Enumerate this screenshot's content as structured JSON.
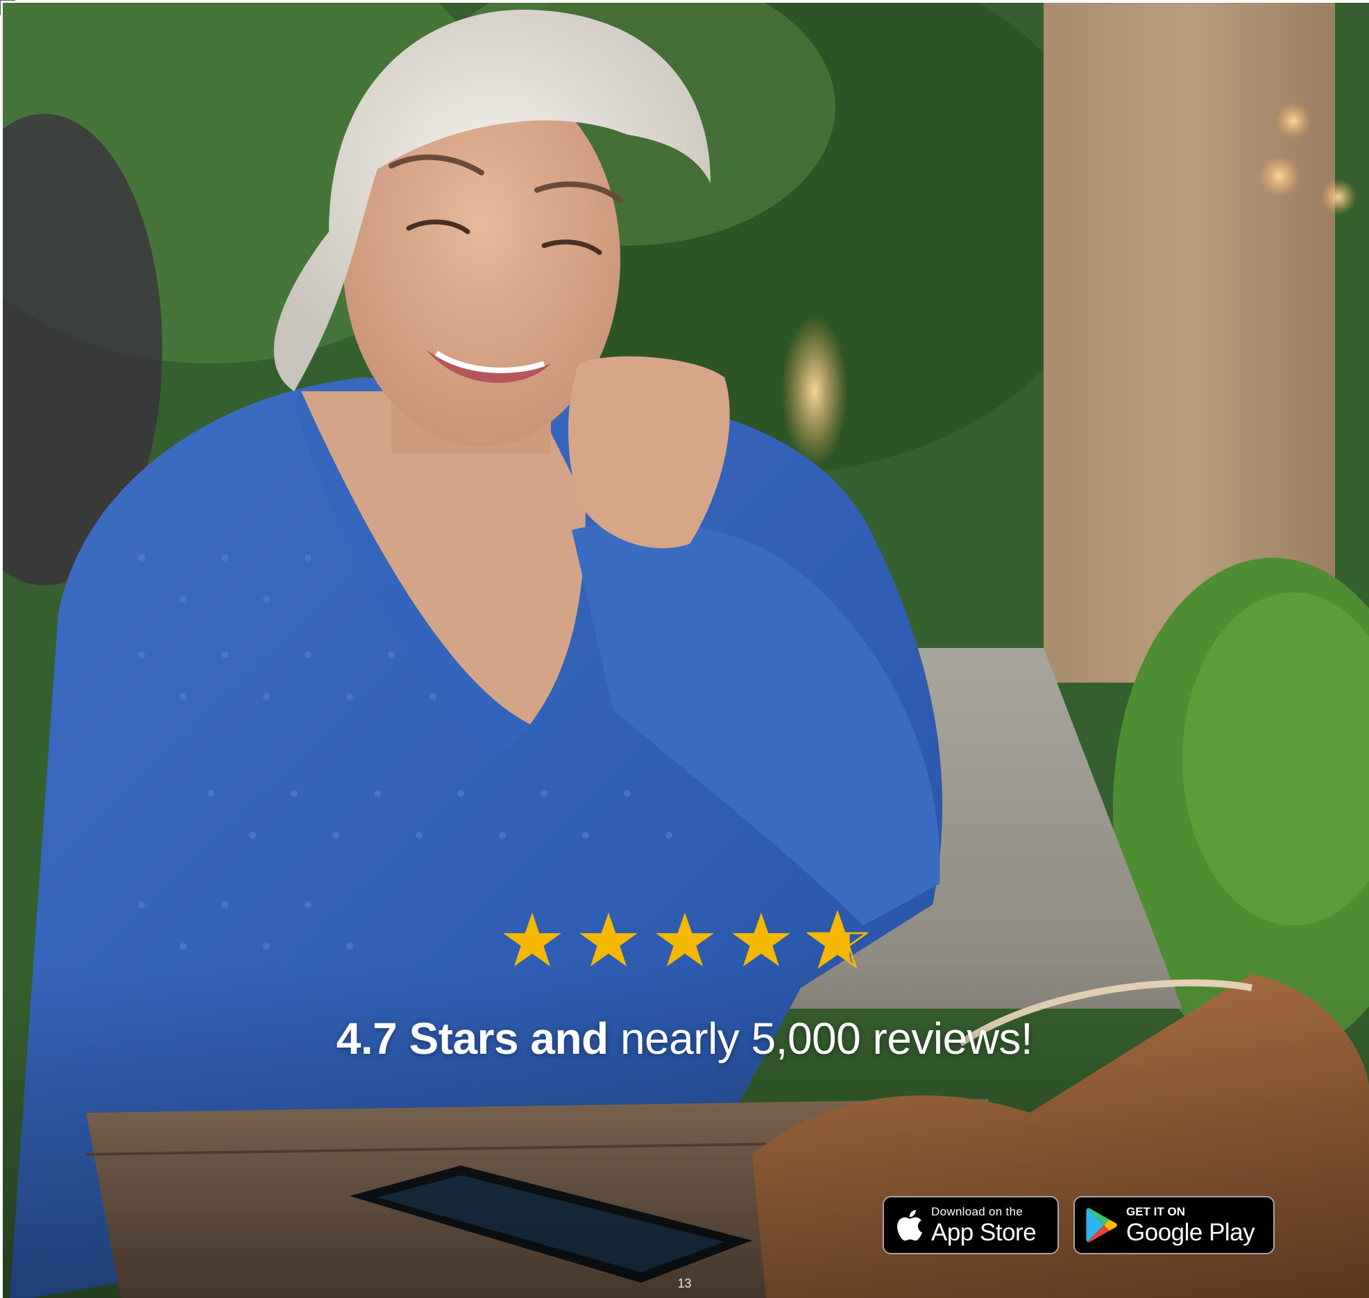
{
  "rating": {
    "value": 4.7,
    "max": 5,
    "star_color": "#f5b800"
  },
  "headline": {
    "bold": "4.7 Stars and",
    "regular": " nearly 5,000 reviews!"
  },
  "badges": {
    "app_store": {
      "small": "Download on the",
      "large": "App Store",
      "icon": "apple-icon"
    },
    "google_play": {
      "small": "GET IT ON",
      "large": "Google Play",
      "icon": "google-play-icon"
    }
  },
  "page_number": "13"
}
